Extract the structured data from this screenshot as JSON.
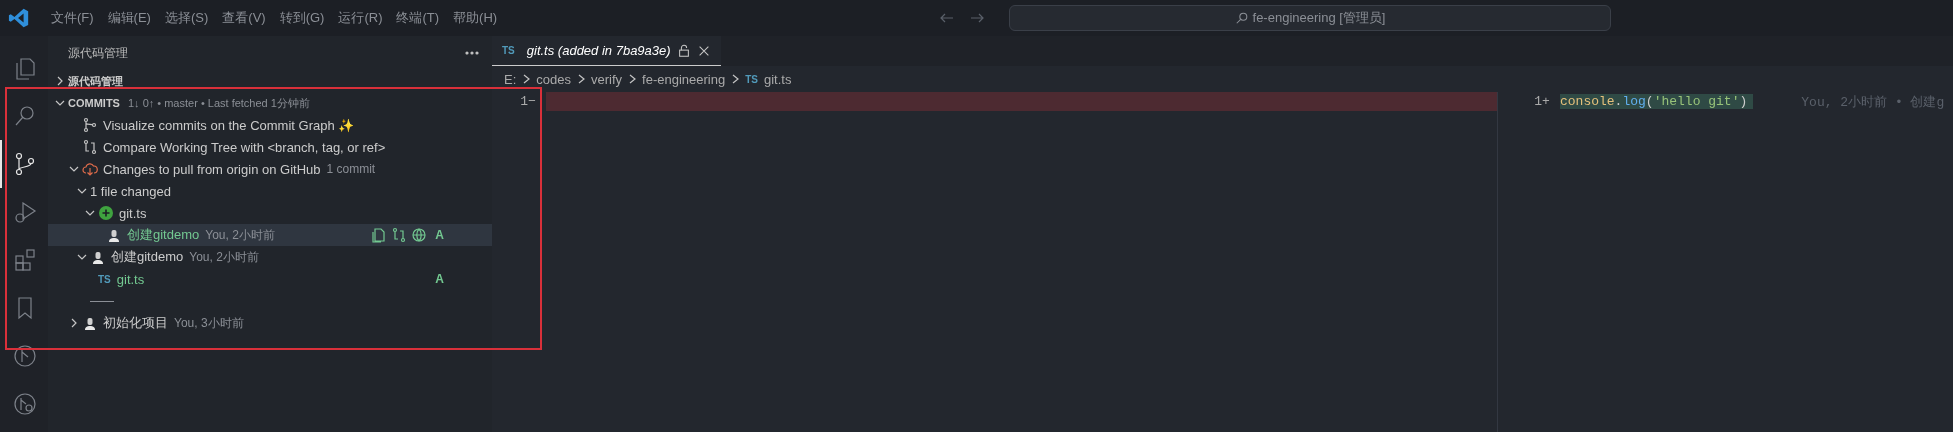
{
  "title_bar": {
    "menus": [
      "文件(F)",
      "编辑(E)",
      "选择(S)",
      "查看(V)",
      "转到(G)",
      "运行(R)",
      "终端(T)",
      "帮助(H)"
    ],
    "search": "fe-engineering [管理员]"
  },
  "activity_bar": [
    {
      "selected": false
    },
    {
      "selected": false
    },
    {
      "selected": true
    },
    {
      "selected": false
    },
    {
      "selected": false
    },
    {
      "selected": false
    },
    {
      "selected": false
    },
    {
      "selected": false
    }
  ],
  "sidebar": {
    "title": "源代码管理",
    "sections": [
      {
        "title": "源代码管理",
        "expanded": false
      }
    ],
    "commits": {
      "title": "COMMITS",
      "info": "1↓ 0↑ • master • Last fetched 1分钟前",
      "expanded": true,
      "items": [
        {
          "kind": "graph",
          "label": "Visualize commits on the Commit Graph ✨",
          "selected": false
        },
        {
          "kind": "compare",
          "label": "Compare Working Tree with <branch, tag, or ref>",
          "selected": false
        },
        {
          "kind": "group",
          "label": "Changes to pull from origin on GitHub",
          "description": "1 commit",
          "expanded": true,
          "selected": false,
          "children": [
            {
              "kind": "folder",
              "label": "1 file changed",
              "expanded": true,
              "selected": false,
              "children": [
                {
                  "kind": "added",
                  "label": "git.ts",
                  "expanded": true,
                  "selected": false,
                  "children": [
                    {
                      "kind": "commit",
                      "label": "创建gitdemo",
                      "description": "You, 2小时前",
                      "status": "A",
                      "selected": true
                    }
                  ]
                }
              ]
            },
            {
              "kind": "commit",
              "label": "创建gitdemo",
              "description": "You, 2小时前",
              "expanded": true,
              "selected": false,
              "children": [
                {
                  "kind": "file",
                  "badge": "TS",
                  "label": "git.ts",
                  "status": "A",
                  "selected": false
                }
              ]
            }
          ]
        },
        {
          "kind": "separator"
        },
        {
          "kind": "commit",
          "label": "初始化项目",
          "description": "You, 3小时前",
          "expanded": false,
          "selected": false
        }
      ]
    }
  },
  "editor": {
    "tabs": [
      {
        "badge": "TS",
        "label": "git.ts (added in 7ba9a3e)",
        "selected": true
      }
    ],
    "breadcrumbs": [
      {
        "label": "E:"
      },
      {
        "label": "codes"
      },
      {
        "label": "verify"
      },
      {
        "label": "fe-engineering"
      },
      {
        "label": "git.ts",
        "badge": "TS"
      }
    ],
    "left": {
      "line": "1",
      "marker": "−"
    },
    "right": {
      "line": "1",
      "marker": "+",
      "tokens": [
        {
          "kind": "variable",
          "text": "console"
        },
        {
          "kind": "punct",
          "text": "."
        },
        {
          "kind": "function",
          "text": "log"
        },
        {
          "kind": "punct",
          "text": "("
        },
        {
          "kind": "string",
          "text": "'hello git'"
        },
        {
          "kind": "punct",
          "text": ")"
        }
      ],
      "blame": "You, 2小时前 • 创建g"
    }
  }
}
